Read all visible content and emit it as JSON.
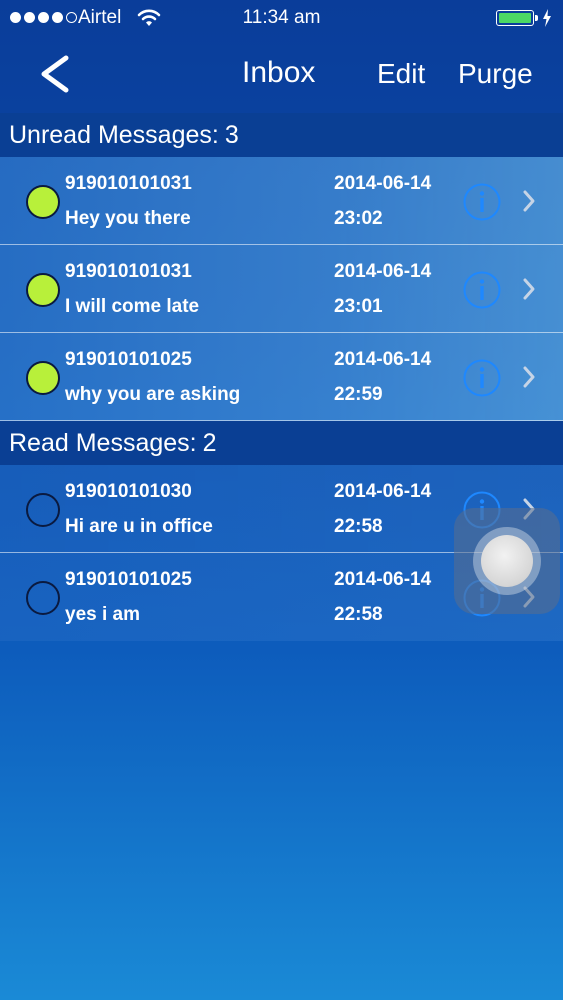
{
  "status_bar": {
    "carrier": "Airtel",
    "time": "11:34 am"
  },
  "nav": {
    "title": "Inbox",
    "edit_label": "Edit",
    "purge_label": "Purge"
  },
  "unread": {
    "label": "Unread Messages:",
    "count": "3",
    "items": [
      {
        "sender": "919010101031",
        "preview": "Hey you there",
        "date": "2014-06-14",
        "time": "23:02"
      },
      {
        "sender": "919010101031",
        "preview": "I will come late",
        "date": "2014-06-14",
        "time": "23:01"
      },
      {
        "sender": "919010101025",
        "preview": "why you are asking",
        "date": "2014-06-14",
        "time": "22:59"
      }
    ]
  },
  "read": {
    "label": "Read Messages:",
    "count": "2",
    "items": [
      {
        "sender": "919010101030",
        "preview": "Hi are u in office",
        "date": "2014-06-14",
        "time": "22:58"
      },
      {
        "sender": "919010101025",
        "preview": "yes i am",
        "date": "2014-06-14",
        "time": "22:58"
      }
    ]
  },
  "colors": {
    "unread_dot": "#b8f03a",
    "info_icon": "#1e88ff",
    "battery": "#4cd964"
  },
  "icons": {
    "back": "chevron-left-icon",
    "info": "info-icon",
    "disclosure": "chevron-right-icon",
    "wifi": "wifi-icon",
    "battery": "battery-icon",
    "charging": "bolt-icon"
  }
}
